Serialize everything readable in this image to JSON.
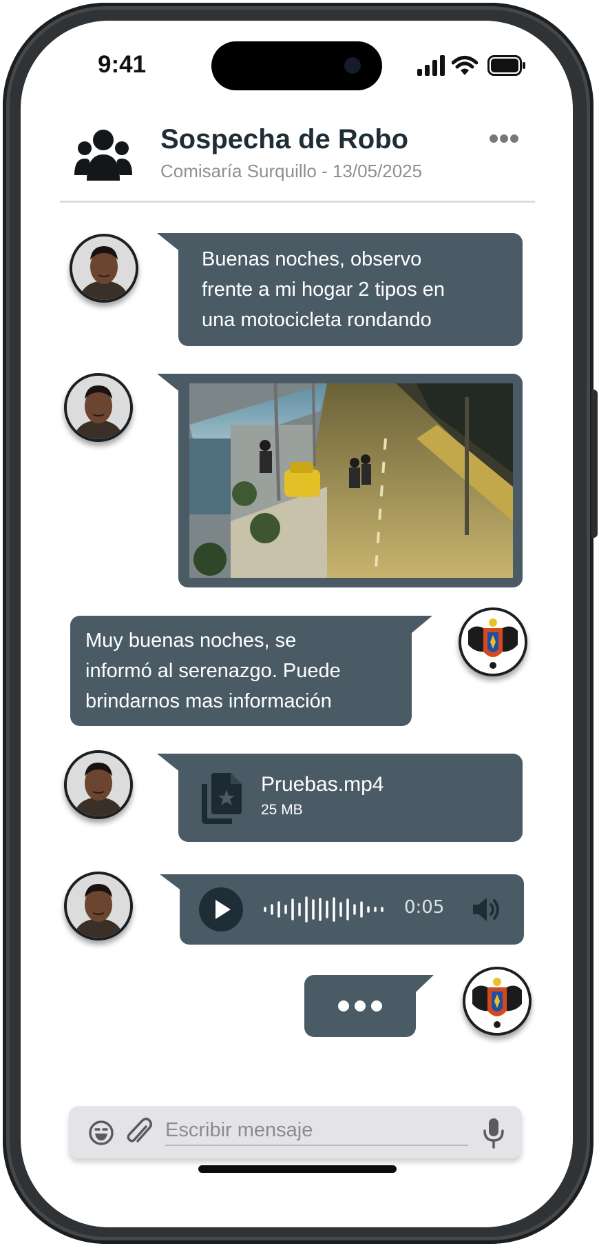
{
  "status_bar": {
    "time": "9:41"
  },
  "header": {
    "title": "Sospecha de Robo",
    "subtitle": "Comisaría Surquillo - 13/05/2025",
    "group_icon": "group-icon",
    "more_icon": "more-horizontal-icon"
  },
  "messages": [
    {
      "sender": "user",
      "type": "text",
      "text_lines": [
        "Buenas noches, observo",
        "frente a mi hogar 2 tipos en",
        "una motocicleta rondando"
      ]
    },
    {
      "sender": "user",
      "type": "image"
    },
    {
      "sender": "police",
      "type": "text",
      "text_lines": [
        "Muy buenas noches, se",
        "informó al serenazgo. Puede",
        "brindarnos mas información"
      ]
    },
    {
      "sender": "user",
      "type": "file",
      "file_name": "Pruebas.mp4",
      "file_size": "25 MB",
      "icon": "file-star-icon"
    },
    {
      "sender": "user",
      "type": "audio",
      "duration": "0:05",
      "icons": [
        "play-icon",
        "waveform-icon",
        "volume-icon"
      ]
    },
    {
      "sender": "police",
      "type": "typing",
      "icon": "typing-dots-icon"
    }
  ],
  "composer": {
    "placeholder": "Escribir mensaje",
    "icons": [
      "emoji-icon",
      "attach-icon",
      "microphone-icon"
    ]
  },
  "colors": {
    "bubble": "#4b5b66",
    "title": "#1f2d36",
    "subtitle": "#8f8f8f",
    "frame": "#2f3336"
  }
}
